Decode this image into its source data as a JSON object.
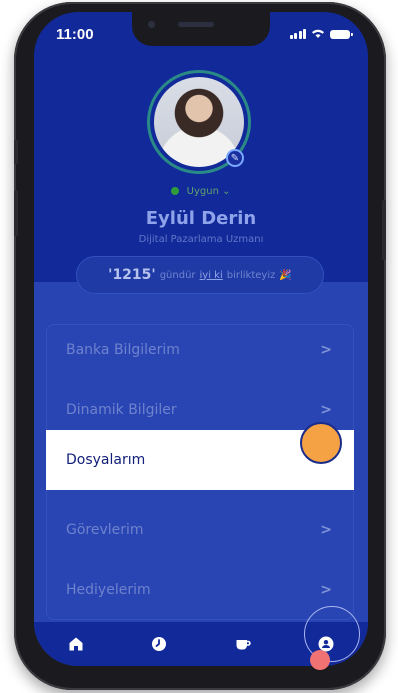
{
  "status_bar": {
    "time": "11:00",
    "icons": [
      "signal-icon",
      "wifi-icon",
      "battery-icon"
    ]
  },
  "profile": {
    "status_label": "Uygun",
    "name": "Eylül Derin",
    "title": "Dijital Pazarlama Uzmanı",
    "days_together": {
      "number": "'1215'",
      "text_before": "gündür",
      "link": "iyi ki",
      "text_after": "birlikteyiz",
      "emoji": "🎉"
    }
  },
  "menu": {
    "items": [
      {
        "label": "Banka Bilgilerim",
        "active": false
      },
      {
        "label": "Dinamik Bilgiler",
        "active": false
      },
      {
        "label": "Dosyalarım",
        "active": true
      },
      {
        "label": "Görevlerim",
        "active": false
      },
      {
        "label": "Hediyelerim",
        "active": false
      }
    ],
    "chevron": ">"
  },
  "bottom_nav": {
    "items": [
      "home-icon",
      "clock-icon",
      "coffee-icon",
      "profile-icon"
    ],
    "active": "profile-icon"
  },
  "colors": {
    "background": "#12299a",
    "active_item_bg": "#ffffff",
    "touch_indicator": "#f4a244"
  }
}
